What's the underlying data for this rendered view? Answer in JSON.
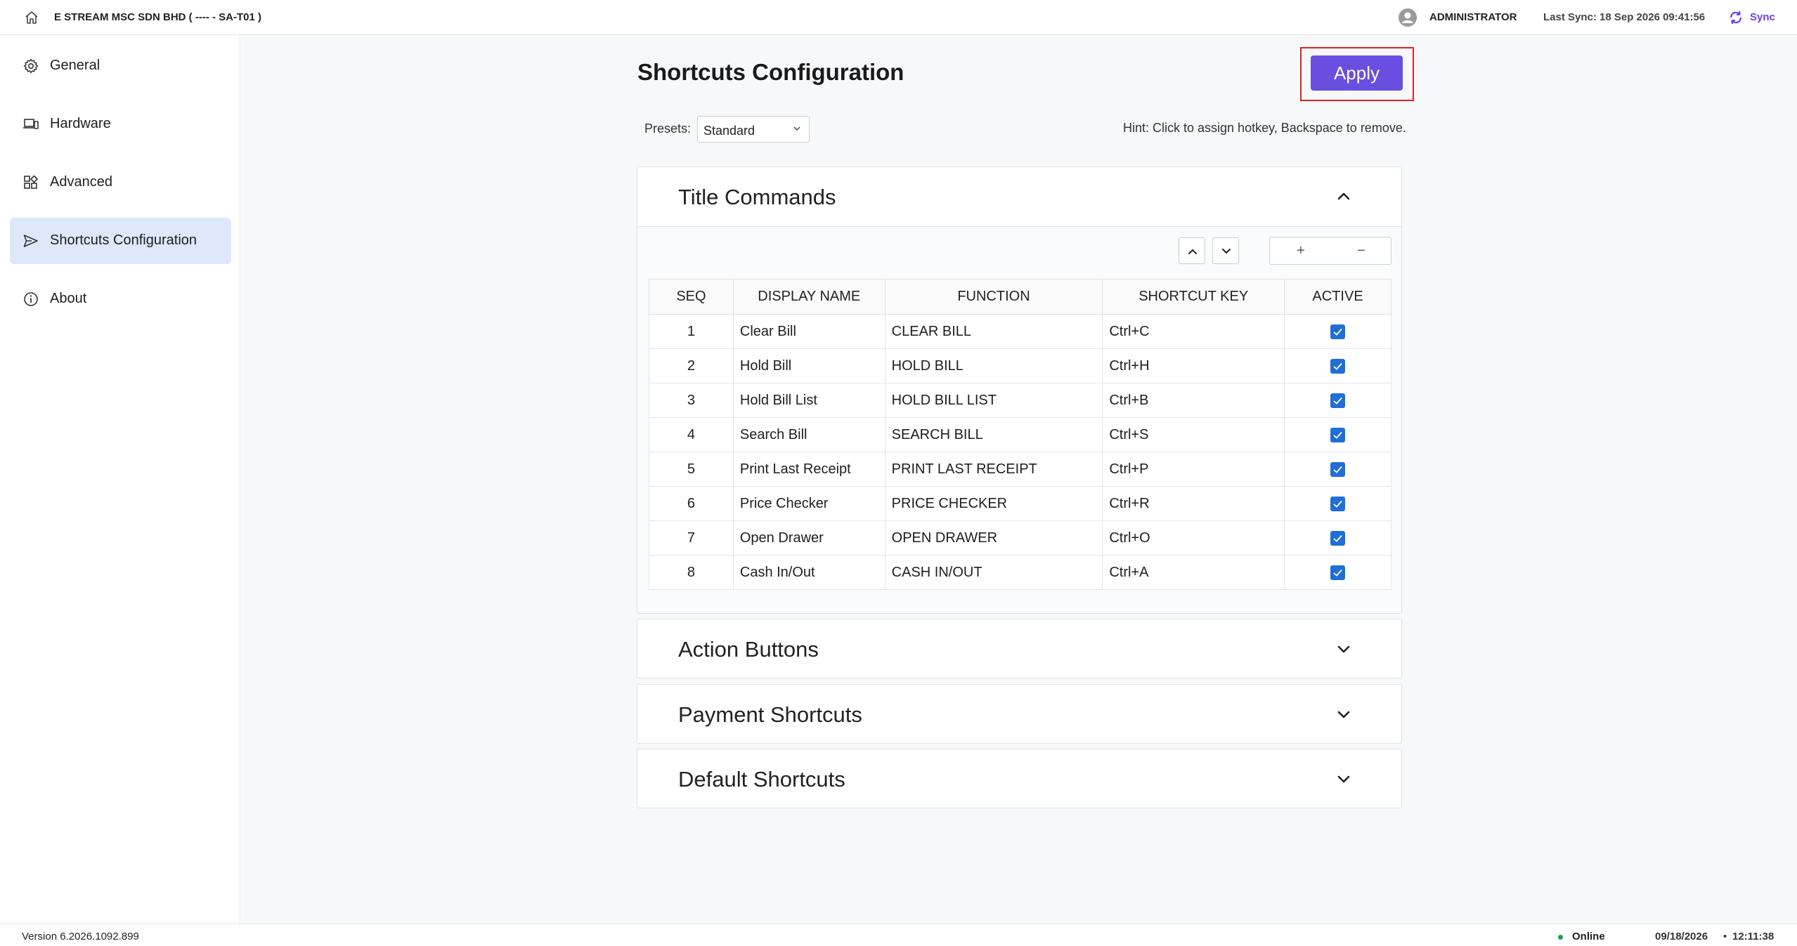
{
  "topbar": {
    "company": "E STREAM MSC SDN BHD ( ---- - SA-T01 )",
    "user": "ADMINISTRATOR",
    "last_sync": "Last Sync: 18 Sep 2026 09:41:56",
    "sync_label": "Sync",
    "accent": "#6a3de8"
  },
  "sidebar": {
    "items": [
      {
        "label": "General",
        "icon": "gear-icon"
      },
      {
        "label": "Hardware",
        "icon": "devices-icon"
      },
      {
        "label": "Advanced",
        "icon": "grid-icon"
      },
      {
        "label": "Shortcuts Configuration",
        "icon": "send-icon",
        "active": true
      },
      {
        "label": "About",
        "icon": "info-icon"
      }
    ]
  },
  "main": {
    "title": "Shortcuts Configuration",
    "apply_label": "Apply",
    "presets_label": "Presets:",
    "preset_value": "Standard",
    "hint": "Hint: Click to assign hotkey, Backspace to remove.",
    "controls": {
      "plus": "+",
      "minus": "−"
    }
  },
  "panels": {
    "title_commands": "Title Commands",
    "action_buttons": "Action Buttons",
    "payment_shortcuts": "Payment Shortcuts",
    "default_shortcuts": "Default Shortcuts"
  },
  "table": {
    "headers": [
      "SEQ",
      "DISPLAY NAME",
      "FUNCTION",
      "SHORTCUT KEY",
      "ACTIVE"
    ],
    "rows": [
      {
        "seq": "1",
        "name": "Clear Bill",
        "function": "CLEAR BILL",
        "key": "Ctrl+C",
        "active": true
      },
      {
        "seq": "2",
        "name": "Hold Bill",
        "function": "HOLD BILL",
        "key": "Ctrl+H",
        "active": true
      },
      {
        "seq": "3",
        "name": "Hold Bill List",
        "function": "HOLD BILL LIST",
        "key": "Ctrl+B",
        "active": true
      },
      {
        "seq": "4",
        "name": "Search Bill",
        "function": "SEARCH BILL",
        "key": "Ctrl+S",
        "active": true
      },
      {
        "seq": "5",
        "name": "Print Last Receipt",
        "function": "PRINT LAST RECEIPT",
        "key": "Ctrl+P",
        "active": true
      },
      {
        "seq": "6",
        "name": "Price Checker",
        "function": "PRICE CHECKER",
        "key": "Ctrl+R",
        "active": true
      },
      {
        "seq": "7",
        "name": "Open Drawer",
        "function": "OPEN DRAWER",
        "key": "Ctrl+O",
        "active": true
      },
      {
        "seq": "8",
        "name": "Cash In/Out",
        "function": "CASH IN/OUT",
        "key": "Ctrl+A",
        "active": true
      }
    ]
  },
  "statusbar": {
    "version": "Version 6.2026.1092.899",
    "online": "Online",
    "date": "09/18/2026",
    "separator": "•",
    "time": "12:11:38"
  }
}
